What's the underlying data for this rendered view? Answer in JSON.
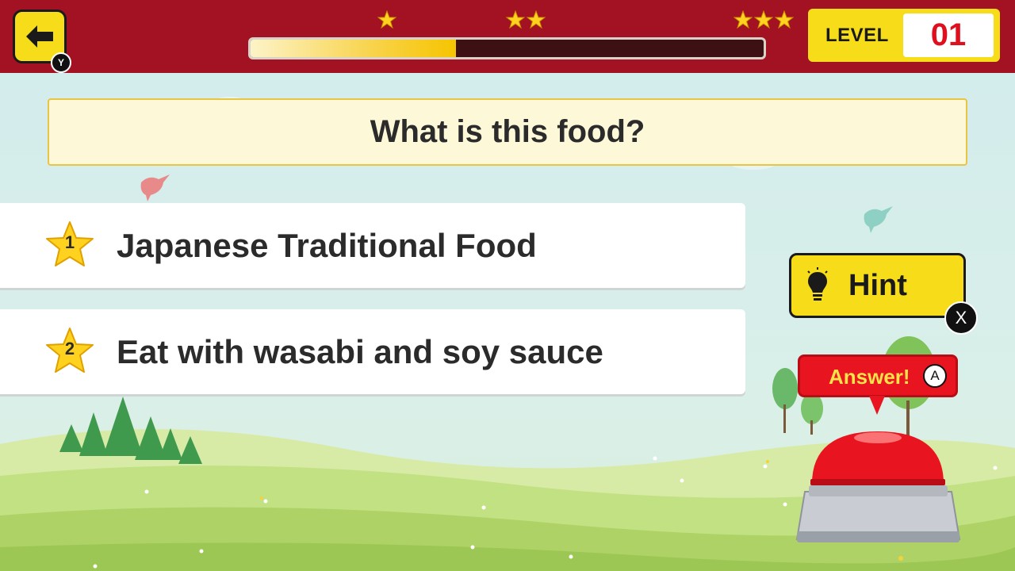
{
  "header": {
    "back_button_key": "Y",
    "progress": {
      "fraction": 0.4
    },
    "star_markers": [
      1,
      2,
      3
    ],
    "level": {
      "label": "LEVEL",
      "value": "01"
    }
  },
  "question": {
    "text": "What is this food?"
  },
  "options": [
    {
      "number": "1",
      "text": "Japanese Traditional Food"
    },
    {
      "number": "2",
      "text": "Eat with wasabi and soy sauce"
    }
  ],
  "hint": {
    "label": "Hint",
    "key": "X"
  },
  "answer": {
    "label": "Answer!",
    "key": "A"
  },
  "colors": {
    "topbar": "#a31222",
    "accent_yellow": "#f7dd19",
    "level_red": "#e00f1e",
    "buzzer_red": "#e8141f"
  }
}
